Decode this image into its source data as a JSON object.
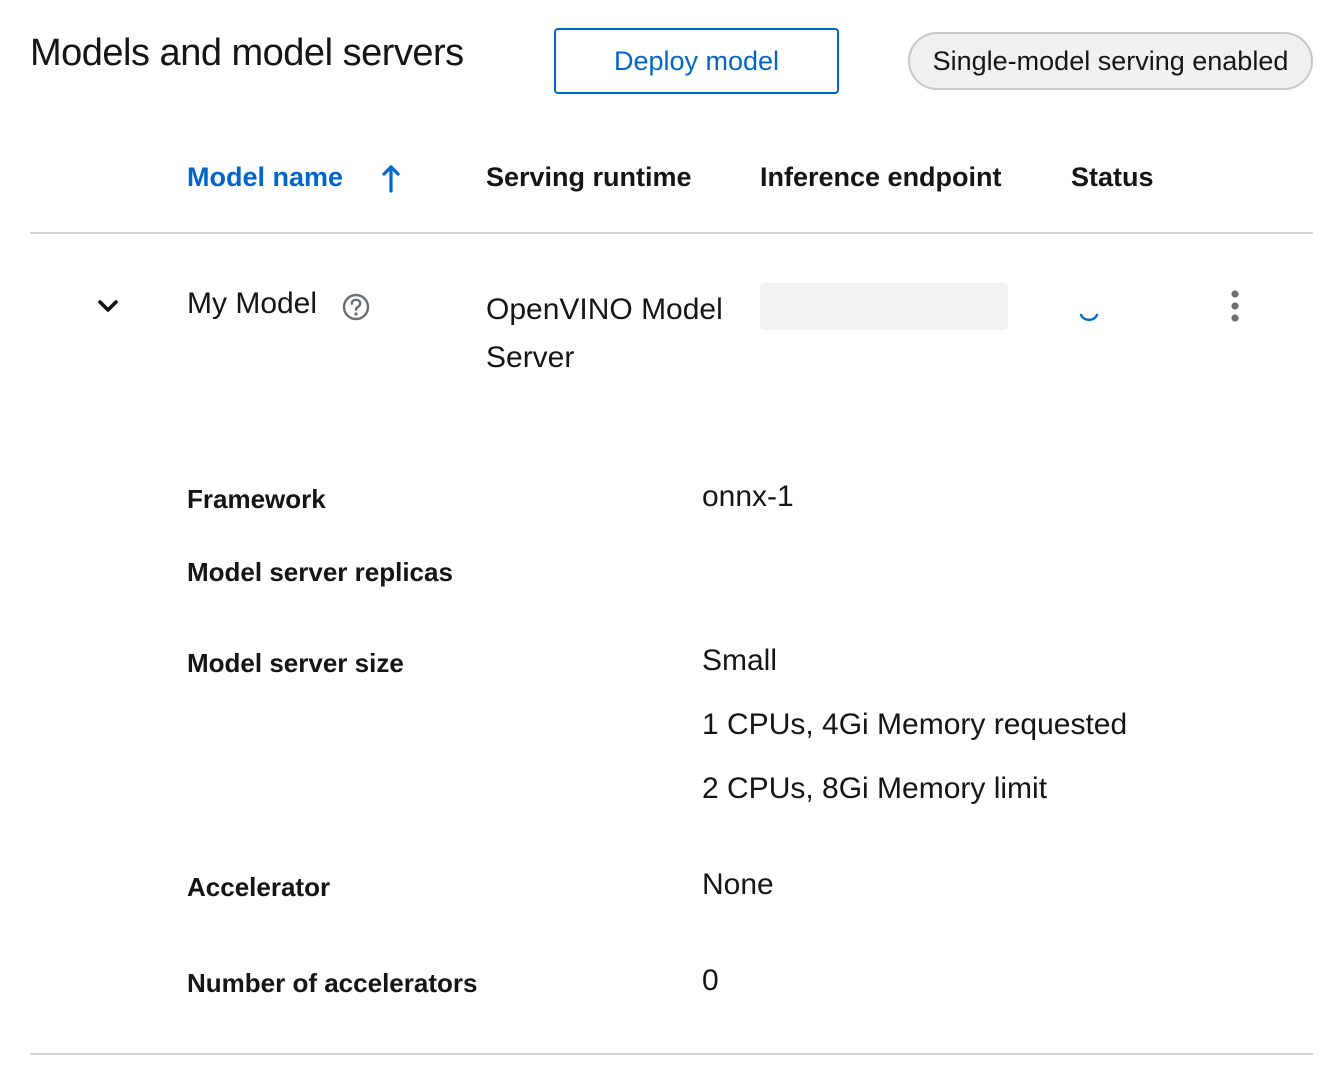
{
  "header": {
    "title": "Models and model servers",
    "deploy_label": "Deploy model",
    "serving_badge": "Single-model serving enabled"
  },
  "table": {
    "columns": [
      "Model name",
      "Serving runtime",
      "Inference endpoint",
      "Status"
    ],
    "sort": {
      "column": "Model name",
      "direction": "ascending",
      "icon": "arrow-up-icon"
    },
    "rows": [
      {
        "name": "My Model",
        "runtime": "OpenVINO Model Server",
        "endpoint_loading": true,
        "status_loading": true,
        "expanded": true,
        "details": {
          "framework_label": "Framework",
          "framework_value": "onnx-1",
          "replicas_label": "Model server replicas",
          "replicas_value": "",
          "size_label": "Model server size",
          "size_value": "Small",
          "size_requested": "1 CPUs, 4Gi Memory requested",
          "size_limit": "2 CPUs, 8Gi Memory limit",
          "accelerator_label": "Accelerator",
          "accelerator_value": "None",
          "num_accelerators_label": "Number of accelerators",
          "num_accelerators_value": "0"
        }
      }
    ]
  },
  "icons": {
    "expand": "chevron-down-icon",
    "help": "question-circle-icon",
    "status": "loading-spinner-icon",
    "actions": "kebab-menu-icon"
  },
  "colors": {
    "link": "#0066cc",
    "text": "#151515",
    "divider": "#d2d2d2",
    "badge_bg": "#f0f0f0",
    "skeleton": "#f2f2f2"
  }
}
